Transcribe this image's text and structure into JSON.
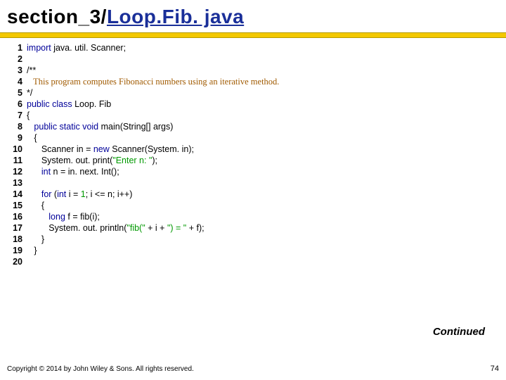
{
  "title_prefix": "section_3/",
  "title_file": "Loop.Fib. java",
  "code": {
    "lines": [
      {
        "n": "1",
        "segments": [
          {
            "cls": "kw",
            "t": "import"
          },
          {
            "cls": "norm",
            "t": " java. util. Scanner;"
          }
        ]
      },
      {
        "n": "2",
        "segments": []
      },
      {
        "n": "3",
        "segments": [
          {
            "cls": "norm",
            "t": "/**"
          }
        ]
      },
      {
        "n": "4",
        "segments": [
          {
            "cls": "jd",
            "t": "   This program computes Fibonacci numbers using an iterative method."
          }
        ]
      },
      {
        "n": "5",
        "segments": [
          {
            "cls": "norm",
            "t": "*/"
          }
        ]
      },
      {
        "n": "6",
        "segments": [
          {
            "cls": "kw",
            "t": "public class"
          },
          {
            "cls": "norm",
            "t": " Loop. Fib"
          }
        ]
      },
      {
        "n": "7",
        "segments": [
          {
            "cls": "norm",
            "t": "{"
          }
        ]
      },
      {
        "n": "8",
        "segments": [
          {
            "cls": "norm",
            "t": "   "
          },
          {
            "cls": "kw",
            "t": "public static void"
          },
          {
            "cls": "norm",
            "t": " main(String[] args)"
          }
        ]
      },
      {
        "n": "9",
        "segments": [
          {
            "cls": "norm",
            "t": "   {"
          }
        ]
      },
      {
        "n": "10",
        "segments": [
          {
            "cls": "norm",
            "t": "      Scanner in = "
          },
          {
            "cls": "kw",
            "t": "new"
          },
          {
            "cls": "norm",
            "t": " Scanner(System. in);"
          }
        ]
      },
      {
        "n": "11",
        "segments": [
          {
            "cls": "norm",
            "t": "      System. out. print("
          },
          {
            "cls": "str",
            "t": "\"Enter n: \""
          },
          {
            "cls": "norm",
            "t": ");"
          }
        ]
      },
      {
        "n": "12",
        "segments": [
          {
            "cls": "norm",
            "t": "      "
          },
          {
            "cls": "kw",
            "t": "int"
          },
          {
            "cls": "norm",
            "t": " n = in. next. Int();"
          }
        ]
      },
      {
        "n": "13",
        "segments": []
      },
      {
        "n": "14",
        "segments": [
          {
            "cls": "norm",
            "t": "      "
          },
          {
            "cls": "kw",
            "t": "for"
          },
          {
            "cls": "norm",
            "t": " ("
          },
          {
            "cls": "kw",
            "t": "int"
          },
          {
            "cls": "norm",
            "t": " i = "
          },
          {
            "cls": "num",
            "t": "1"
          },
          {
            "cls": "norm",
            "t": "; i <= n; i++)"
          }
        ]
      },
      {
        "n": "15",
        "segments": [
          {
            "cls": "norm",
            "t": "      {"
          }
        ]
      },
      {
        "n": "16",
        "segments": [
          {
            "cls": "norm",
            "t": "         "
          },
          {
            "cls": "kw",
            "t": "long"
          },
          {
            "cls": "norm",
            "t": " f = fib(i);"
          }
        ]
      },
      {
        "n": "17",
        "segments": [
          {
            "cls": "norm",
            "t": "         System. out. println("
          },
          {
            "cls": "str",
            "t": "\"fib(\""
          },
          {
            "cls": "norm",
            "t": " + i + "
          },
          {
            "cls": "str",
            "t": "\") = \""
          },
          {
            "cls": "norm",
            "t": " + f);"
          }
        ]
      },
      {
        "n": "18",
        "segments": [
          {
            "cls": "norm",
            "t": "      }"
          }
        ]
      },
      {
        "n": "19",
        "segments": [
          {
            "cls": "norm",
            "t": "   }"
          }
        ]
      },
      {
        "n": "20",
        "segments": []
      }
    ]
  },
  "continued": "Continued",
  "footer": "Copyright © 2014 by John Wiley & Sons. All rights reserved.",
  "page": "74"
}
